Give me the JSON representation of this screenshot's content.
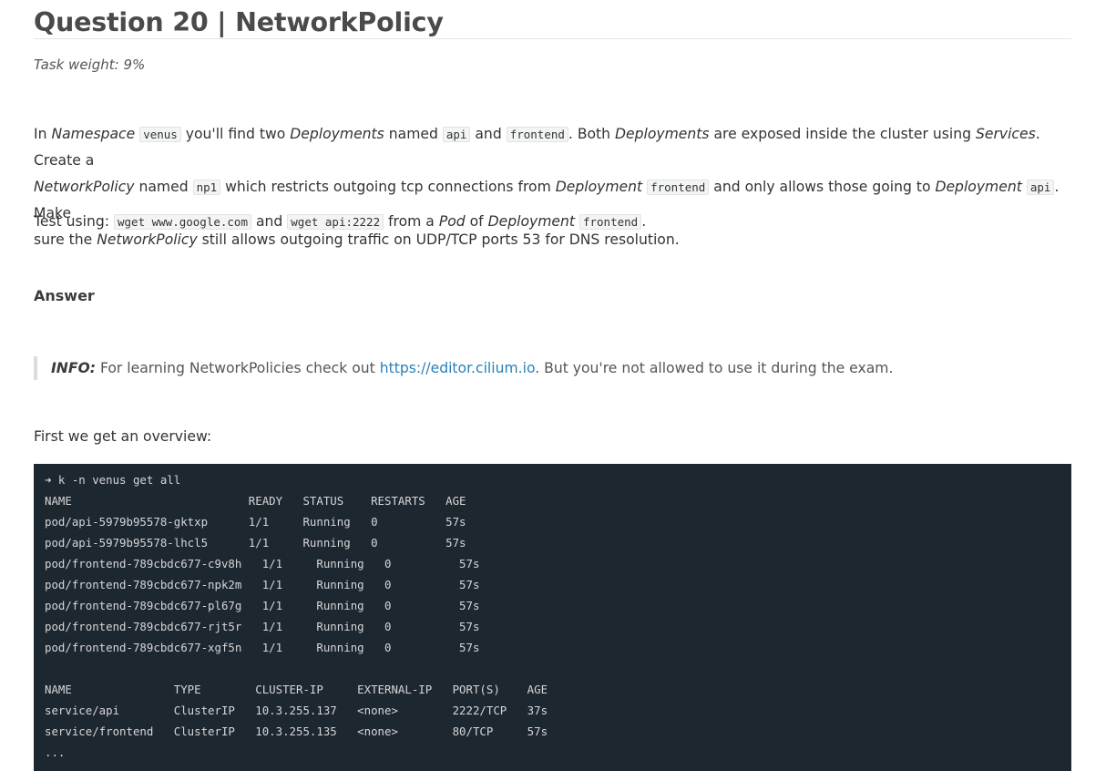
{
  "title": "Question 20 | NetworkPolicy",
  "task_weight": "Task weight: 9%",
  "para1": {
    "t1": "In ",
    "ns_label": "Namespace",
    "t2": " ",
    "ns_code": "venus",
    "t3": " you'll find two ",
    "deployments1": "Deployments",
    "t4": " named ",
    "api_code": "api",
    "t5": " and ",
    "frontend_code": "frontend",
    "t6": ". Both ",
    "deployments2": "Deployments",
    "t7": " are exposed inside the cluster using ",
    "services": "Services",
    "t8": ". Create a",
    "networkpolicy1": "NetworkPolicy",
    "t9": " named ",
    "np1_code": "np1",
    "t10": " which restricts outgoing tcp connections from ",
    "deployment1": "Deployment",
    "t11": " ",
    "frontend_code2": "frontend",
    "t12": " and only allows those going to ",
    "deployment2": "Deployment",
    "t13": " ",
    "api_code2": "api",
    "t14": ". Make",
    "t15": "sure the ",
    "networkpolicy2": "NetworkPolicy",
    "t16": " still allows outgoing traffic on UDP/TCP ports 53 for DNS resolution."
  },
  "para2": {
    "t1": "Test using: ",
    "code1": "wget www.google.com",
    "t2": " and ",
    "code2": "wget api:2222",
    "t3": " from a ",
    "pod": "Pod",
    "t4": " of ",
    "deployment": "Deployment",
    "t5": " ",
    "code3": "frontend",
    "t6": "."
  },
  "answer_heading": "Answer",
  "info": {
    "label": "INFO:",
    "t1": " For learning NetworkPolicies check out ",
    "link": "https://editor.cilium.io",
    "t2": ". But you're not allowed to use it during the exam."
  },
  "overview_text": "First we get an overview:",
  "terminal": [
    "➜ k -n venus get all",
    "NAME                          READY   STATUS    RESTARTS   AGE",
    "pod/api-5979b95578-gktxp      1/1     Running   0          57s",
    "pod/api-5979b95578-lhcl5      1/1     Running   0          57s",
    "pod/frontend-789cbdc677-c9v8h   1/1     Running   0          57s",
    "pod/frontend-789cbdc677-npk2m   1/1     Running   0          57s",
    "pod/frontend-789cbdc677-pl67g   1/1     Running   0          57s",
    "pod/frontend-789cbdc677-rjt5r   1/1     Running   0          57s",
    "pod/frontend-789cbdc677-xgf5n   1/1     Running   0          57s",
    "",
    "NAME               TYPE        CLUSTER-IP     EXTERNAL-IP   PORT(S)    AGE",
    "service/api        ClusterIP   10.3.255.137   <none>        2222/TCP   37s",
    "service/frontend   ClusterIP   10.3.255.135   <none>        80/TCP     57s",
    "..."
  ]
}
